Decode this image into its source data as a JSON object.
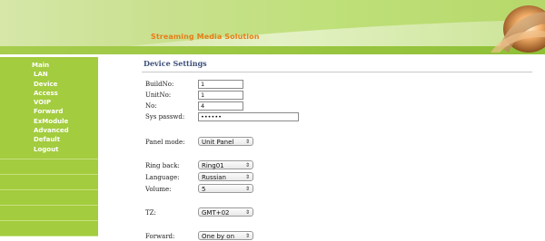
{
  "header": {
    "title": "Streaming Media Solution"
  },
  "sidebar": {
    "items": [
      {
        "label": "Main"
      },
      {
        "label": "LAN"
      },
      {
        "label": "Device"
      },
      {
        "label": "Access"
      },
      {
        "label": "VOIP"
      },
      {
        "label": "Forward"
      },
      {
        "label": "ExModule"
      },
      {
        "label": "Advanced"
      },
      {
        "label": "Default"
      },
      {
        "label": "Logout"
      }
    ]
  },
  "main": {
    "page_title": "Device Settings",
    "fields": {
      "build_no": {
        "label": "BuildNo:",
        "value": "1"
      },
      "unit_no": {
        "label": "UnitNo:",
        "value": "1"
      },
      "no": {
        "label": "No:",
        "value": "4"
      },
      "sys_passwd": {
        "label": "Sys passwd:",
        "value": "••••••"
      },
      "panel_mode": {
        "label": "Panel mode:",
        "value": "Unit Panel"
      },
      "ring_back": {
        "label": "Ring back:",
        "value": "Ring01"
      },
      "language": {
        "label": "Language:",
        "value": "Russian"
      },
      "volume": {
        "label": "Volume:",
        "value": "5"
      },
      "tz": {
        "label": "TZ:",
        "value": "GMT+02"
      },
      "forward": {
        "label": "Forward:",
        "value": "One by on"
      }
    }
  },
  "select_arrow": "⇕",
  "colors": {
    "sidebar_bg": "#a3cc3e",
    "header_title": "#e87d18",
    "page_title": "#3c4e7a"
  }
}
